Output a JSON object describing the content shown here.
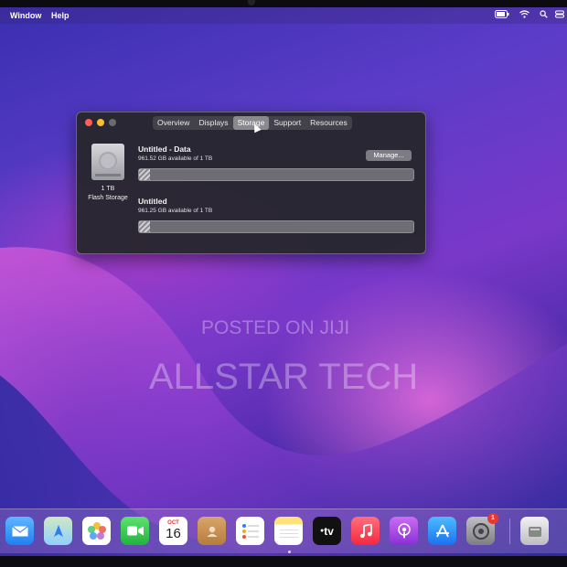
{
  "menubar": {
    "items": [
      "Window",
      "Help"
    ],
    "status_icons": [
      "battery-icon",
      "wifi-icon",
      "search-icon",
      "control-center-icon"
    ]
  },
  "window": {
    "tabs": [
      {
        "label": "Overview",
        "selected": false
      },
      {
        "label": "Displays",
        "selected": false
      },
      {
        "label": "Storage",
        "selected": true
      },
      {
        "label": "Support",
        "selected": false
      },
      {
        "label": "Resources",
        "selected": false
      }
    ],
    "drive": {
      "capacity": "1 TB",
      "type": "Flash Storage"
    },
    "volumes": [
      {
        "name": "Untitled - Data",
        "available": "961.52 GB available of 1 TB",
        "used_fraction": 0.04
      },
      {
        "name": "Untitled",
        "available": "961.25 GB available of 1 TB",
        "used_fraction": 0.04
      }
    ],
    "manage_label": "Manage..."
  },
  "watermark": {
    "line1": "POSTED ON JIJI",
    "line2": "ALLSTAR TECH"
  },
  "dock": {
    "calendar_month": "OCT",
    "calendar_day": "16",
    "tv_label": "tv",
    "settings_badge": "1",
    "apps": [
      "mail-icon",
      "maps-icon",
      "photos-icon",
      "facetime-icon",
      "calendar-icon",
      "contacts-icon",
      "reminders-icon",
      "notes-icon",
      "apple-tv-icon",
      "music-icon",
      "podcasts-icon",
      "app-store-icon",
      "system-preferences-icon",
      "disk-utility-icon"
    ]
  },
  "colors": {
    "window_bg": "#28262e",
    "tab_selected": "#8a8990",
    "accent_pink": "#ff78e6"
  }
}
